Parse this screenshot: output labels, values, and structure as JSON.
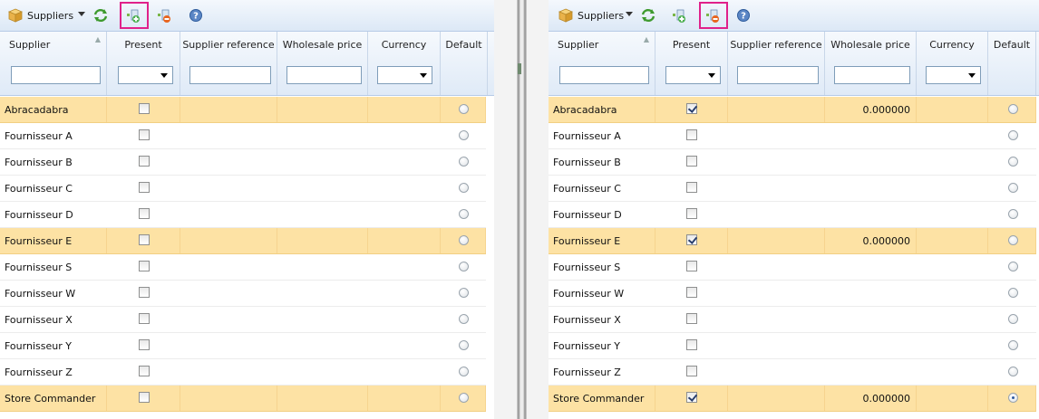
{
  "toolbar": {
    "title": "Suppliers"
  },
  "columns": {
    "supplier": "Supplier",
    "present": "Present",
    "supplier_reference": "Supplier reference",
    "wholesale_price": "Wholesale price",
    "currency": "Currency",
    "default": "Default"
  },
  "left": {
    "rows": [
      {
        "name": "Abracadabra",
        "present": false,
        "price": "",
        "default": false,
        "selected": true
      },
      {
        "name": "Fournisseur A",
        "present": false,
        "price": "",
        "default": false,
        "selected": false
      },
      {
        "name": "Fournisseur B",
        "present": false,
        "price": "",
        "default": false,
        "selected": false
      },
      {
        "name": "Fournisseur C",
        "present": false,
        "price": "",
        "default": false,
        "selected": false
      },
      {
        "name": "Fournisseur D",
        "present": false,
        "price": "",
        "default": false,
        "selected": false
      },
      {
        "name": "Fournisseur E",
        "present": false,
        "price": "",
        "default": false,
        "selected": true
      },
      {
        "name": "Fournisseur S",
        "present": false,
        "price": "",
        "default": false,
        "selected": false
      },
      {
        "name": "Fournisseur W",
        "present": false,
        "price": "",
        "default": false,
        "selected": false
      },
      {
        "name": "Fournisseur X",
        "present": false,
        "price": "",
        "default": false,
        "selected": false
      },
      {
        "name": "Fournisseur Y",
        "present": false,
        "price": "",
        "default": false,
        "selected": false
      },
      {
        "name": "Fournisseur Z",
        "present": false,
        "price": "",
        "default": false,
        "selected": false
      },
      {
        "name": "Store Commander",
        "present": false,
        "price": "",
        "default": false,
        "selected": true
      }
    ]
  },
  "right": {
    "rows": [
      {
        "name": "Abracadabra",
        "present": true,
        "price": "0.000000",
        "default": false,
        "selected": true
      },
      {
        "name": "Fournisseur A",
        "present": false,
        "price": "",
        "default": false,
        "selected": false
      },
      {
        "name": "Fournisseur B",
        "present": false,
        "price": "",
        "default": false,
        "selected": false
      },
      {
        "name": "Fournisseur C",
        "present": false,
        "price": "",
        "default": false,
        "selected": false
      },
      {
        "name": "Fournisseur D",
        "present": false,
        "price": "",
        "default": false,
        "selected": false
      },
      {
        "name": "Fournisseur E",
        "present": true,
        "price": "0.000000",
        "default": false,
        "selected": true
      },
      {
        "name": "Fournisseur S",
        "present": false,
        "price": "",
        "default": false,
        "selected": false
      },
      {
        "name": "Fournisseur W",
        "present": false,
        "price": "",
        "default": false,
        "selected": false
      },
      {
        "name": "Fournisseur X",
        "present": false,
        "price": "",
        "default": false,
        "selected": false
      },
      {
        "name": "Fournisseur Y",
        "present": false,
        "price": "",
        "default": false,
        "selected": false
      },
      {
        "name": "Fournisseur Z",
        "present": false,
        "price": "",
        "default": false,
        "selected": false
      },
      {
        "name": "Store Commander",
        "present": true,
        "price": "0.000000",
        "default": true,
        "selected": true
      }
    ]
  },
  "colors": {
    "selected_row": "#fde2a4",
    "highlight_outline": "#e0218a"
  },
  "icons": {
    "title": "package-icon",
    "refresh": "refresh-icon",
    "add_supplier": "add-supplier-icon",
    "remove_supplier": "remove-supplier-icon",
    "help": "help-icon"
  }
}
